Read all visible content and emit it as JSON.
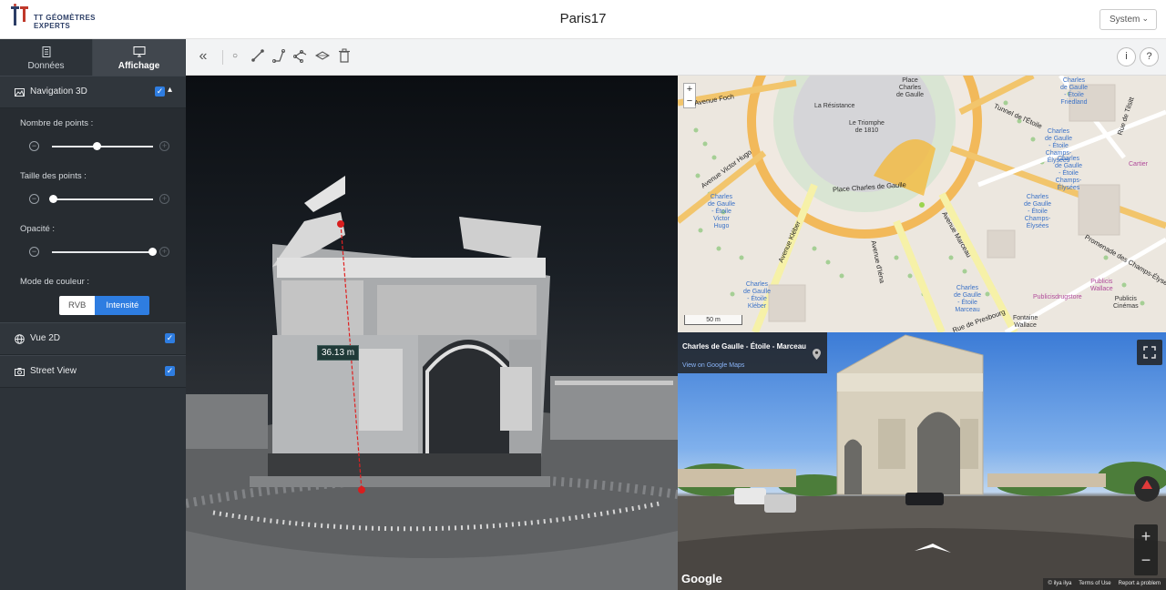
{
  "header": {
    "logo_line1": "TT GÉOMÈTRES",
    "logo_line2": "EXPERTS",
    "title": "Paris17",
    "theme_select": "System"
  },
  "sidebar": {
    "tabs": [
      {
        "label": "Données",
        "icon": "document-icon",
        "active": false
      },
      {
        "label": "Affichage",
        "icon": "monitor-icon",
        "active": true
      }
    ],
    "nav3d": {
      "label": "Navigation 3D",
      "checked": true,
      "point_count_label": "Nombre de points :",
      "point_count_value": 0.44,
      "point_size_label": "Taille des points :",
      "point_size_value": 0.0,
      "opacity_label": "Opacité :",
      "opacity_value": 1.0,
      "color_mode_label": "Mode de couleur :",
      "color_modes": [
        "RVB",
        "Intensité"
      ],
      "color_mode_selected": "Intensité"
    },
    "vue2d": {
      "label": "Vue 2D",
      "checked": true
    },
    "streetview": {
      "label": "Street View",
      "checked": true
    }
  },
  "viewport": {
    "measurement": "36.13 m"
  },
  "map": {
    "scale": "50 m",
    "labels": {
      "place_cdg": "Place\nCharles\nde Gaulle",
      "resistance": "La Résistance",
      "triomphe": "Le Triomphe\nde 1810",
      "foch": "Avenue Foch",
      "hugo": "Avenue Victor Hugo",
      "kleber": "Avenue Kléber",
      "iena": "Avenue d'Iéna",
      "marceau": "Avenue Marceau",
      "place_road": "Place Charles de Gaulle",
      "friedland": "Charles\nde Gaulle\n- Étoile\nFriedland",
      "tunnel": "Tunnel de l'Étoile",
      "tilsitt": "Rue de Tilsitt",
      "champs": "Champs-Élysées",
      "promenade": "Promenade des Champs-Élysées",
      "cartier": "Cartier",
      "publicis_drug": "Publicisdrugstore",
      "publicis_wallace": "Publicis\nWallace",
      "publicis_cinemas": "Publicis\nCinémas",
      "presbourg": "Rue de Presbourg",
      "fontaine": "Fontaine\nWallace",
      "cdg_hugo": "Charles\nde Gaulle\n- Étoile\nVictor\nHugo",
      "cdg_kleber": "Charles\nde Gaulle\n- Étoile\nKléber",
      "cdg_marceau": "Charles\nde Gaulle\n- Étoile\nMarceau",
      "cdg_champs1": "Charles\nde Gaulle\n- Étoile\nChamps-\nÉlysées",
      "cdg_champs2": "Charles\nde Gaulle\n- Étoile\nChamps-\nÉlysées",
      "cdg_champs3": "Charles\nde Gaulle\n- Étoile\nChamps-\nÉlysées"
    }
  },
  "streetview": {
    "title": "Charles de Gaulle - Étoile - Marceau",
    "link": "View on Google Maps",
    "logo": "Google",
    "footer": [
      "© ilya ilya",
      "Terms of Use",
      "Report a problem"
    ]
  }
}
